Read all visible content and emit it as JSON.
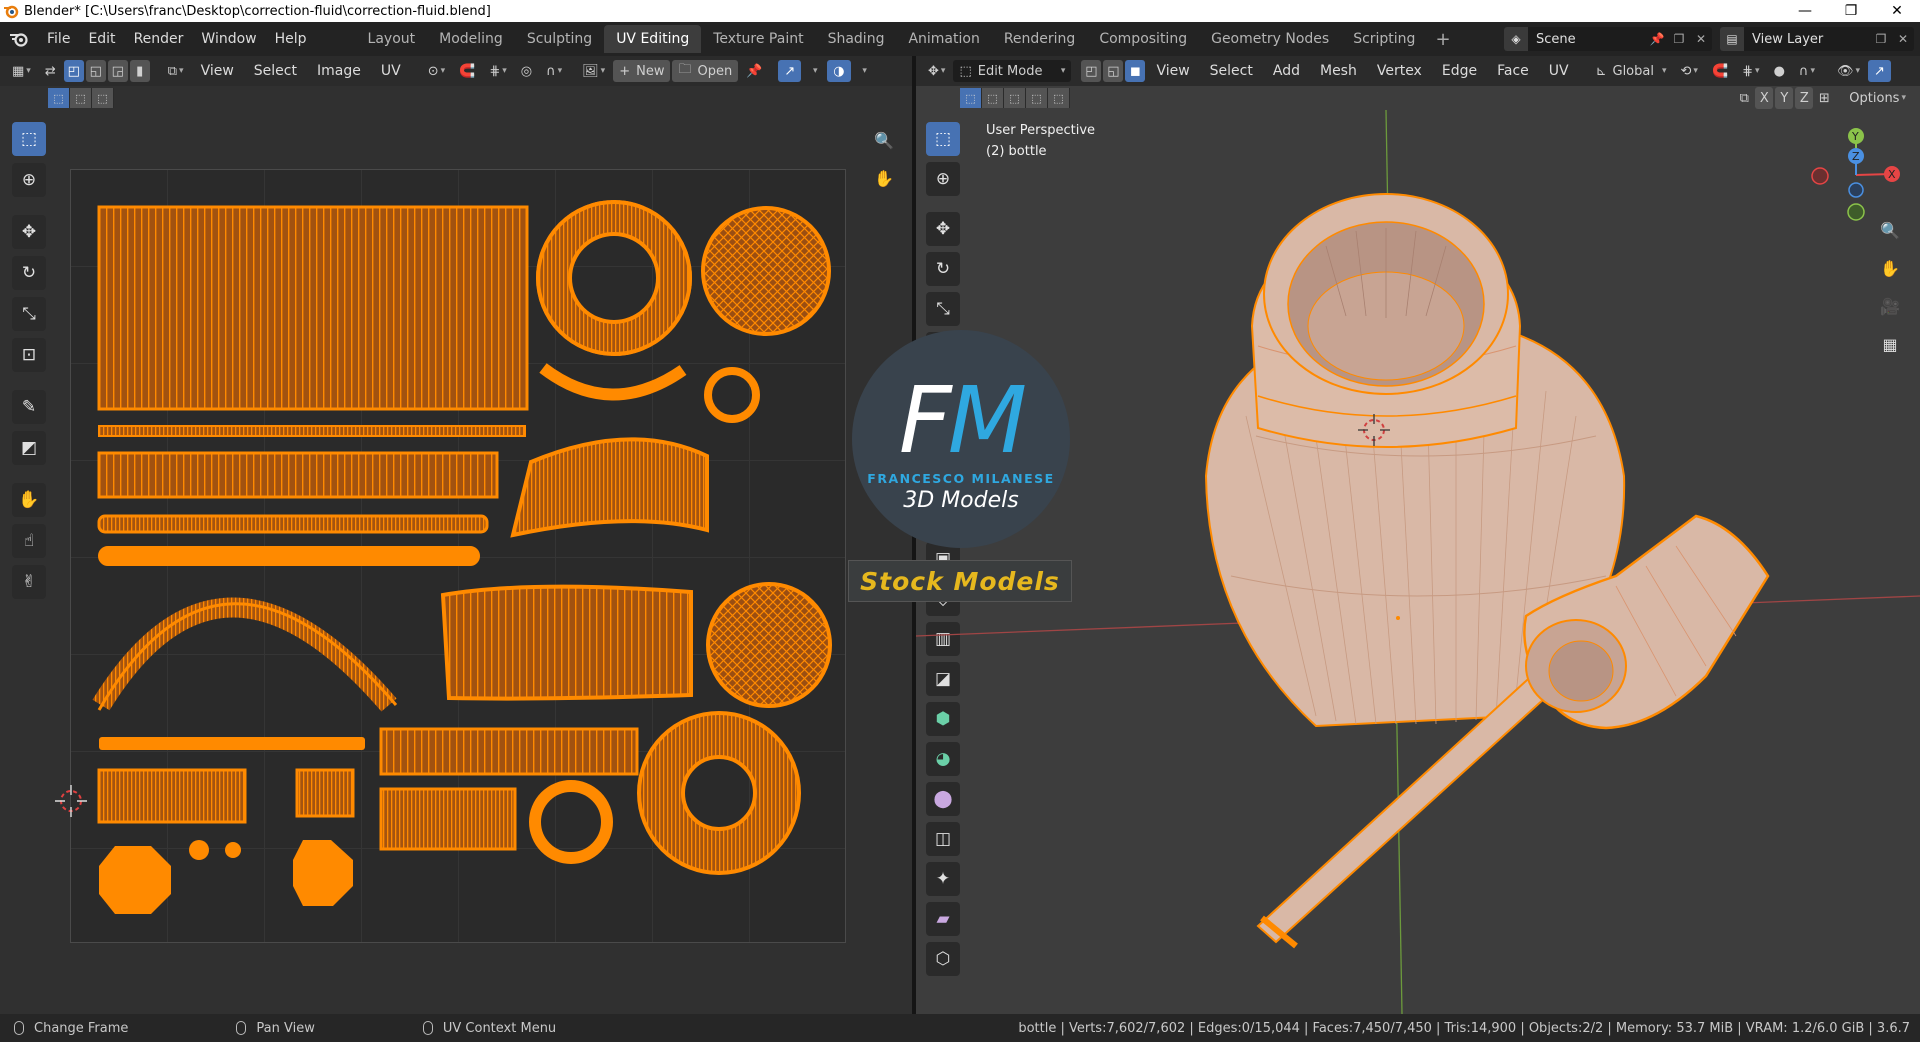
{
  "window": {
    "title": "Blender* [C:\\Users\\franc\\Desktop\\correction-fluid\\correction-fluid.blend]",
    "controls": [
      "—",
      "❐",
      "✕"
    ]
  },
  "menu": [
    "File",
    "Edit",
    "Render",
    "Window",
    "Help"
  ],
  "workspaces": [
    {
      "label": "Layout",
      "active": false
    },
    {
      "label": "Modeling",
      "active": false
    },
    {
      "label": "Sculpting",
      "active": false
    },
    {
      "label": "UV Editing",
      "active": true
    },
    {
      "label": "Texture Paint",
      "active": false
    },
    {
      "label": "Shading",
      "active": false
    },
    {
      "label": "Animation",
      "active": false
    },
    {
      "label": "Rendering",
      "active": false
    },
    {
      "label": "Compositing",
      "active": false
    },
    {
      "label": "Geometry Nodes",
      "active": false
    },
    {
      "label": "Scripting",
      "active": false
    }
  ],
  "scene": {
    "label": "Scene",
    "view_layer": "View Layer"
  },
  "uv_editor": {
    "menus": [
      "View",
      "Select",
      "Image",
      "UV"
    ],
    "new_label": "New",
    "open_label": "Open"
  },
  "viewport": {
    "mode": "Edit Mode",
    "menus": [
      "View",
      "Select",
      "Add",
      "Mesh",
      "Vertex",
      "Edge",
      "Face",
      "UV"
    ],
    "transform_orientation": "Global",
    "options_label": "Options",
    "axis_toggles": [
      "X",
      "Y",
      "Z"
    ],
    "perspective": "User Perspective",
    "object": "(2) bottle",
    "gizmo": {
      "x": "X",
      "y": "Y",
      "z": "Z"
    }
  },
  "watermark": {
    "letter_f": "F",
    "letter_m": "M",
    "name": "FRANCESCO MILANESE",
    "subtitle": "3D Models",
    "banner": "Stock Models"
  },
  "statusbar": {
    "items": [
      "Change Frame",
      "Pan View",
      "UV Context Menu"
    ],
    "stats": "bottle | Verts:7,602/7,602 | Edges:0/15,044 | Faces:7,450/7,450 | Tris:14,900 | Objects:2/2 | Memory: 53.7 MiB | VRAM: 1.2/6.0 GiB | 3.6.7"
  },
  "colors": {
    "accent": "#4772b3",
    "uv_orange": "#ff8a00",
    "mesh_fill": "#d9b8a6",
    "wm_blue": "#2fa8e0",
    "wm_gold": "#e6b81e"
  }
}
